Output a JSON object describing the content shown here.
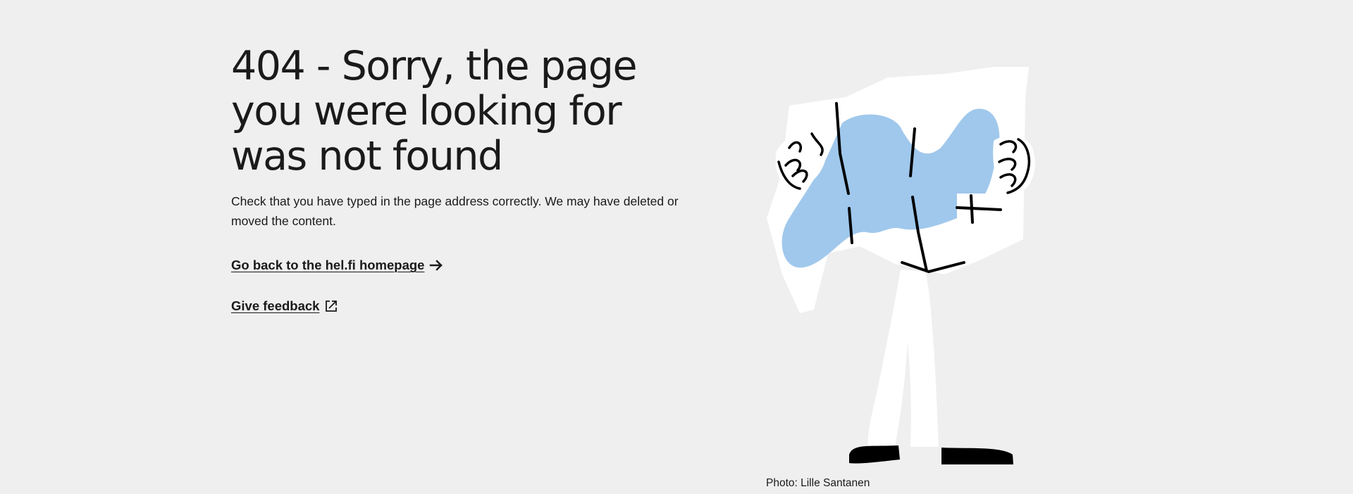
{
  "error": {
    "title": "404 - Sorry, the page you were looking for was not found",
    "description": "Check that you have typed in the page address correctly. We may have deleted or moved the content."
  },
  "links": {
    "home": {
      "label": "Go back to the hel.fi homepage",
      "icon": "arrow-right-icon"
    },
    "feedback": {
      "label": "Give feedback",
      "icon": "external-link-icon"
    }
  },
  "illustration": {
    "icon": "person-holding-map-illustration",
    "credit": "Photo: Lille Santanen"
  },
  "colors": {
    "background": "#efefef",
    "text": "#1a1a1a",
    "map_blue": "#a0c8ec"
  }
}
